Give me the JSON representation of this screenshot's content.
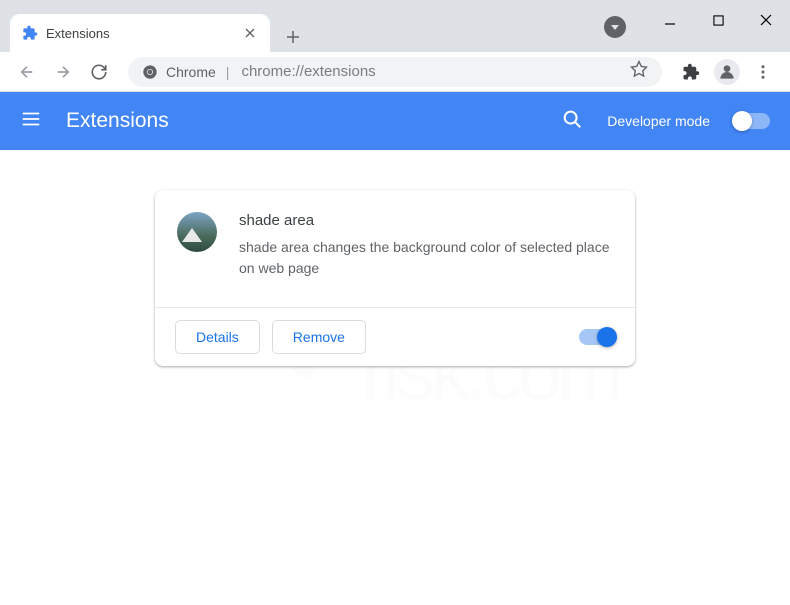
{
  "tab": {
    "title": "Extensions"
  },
  "address": {
    "label": "Chrome",
    "url": "chrome://extensions"
  },
  "header": {
    "title": "Extensions",
    "dev_mode_label": "Developer mode",
    "dev_mode_on": false
  },
  "extension": {
    "name": "shade area",
    "description": "shade area changes the background color of selected place on web page",
    "enabled": true,
    "details_label": "Details",
    "remove_label": "Remove"
  },
  "watermark": {
    "brand": "PCrisk.com"
  }
}
